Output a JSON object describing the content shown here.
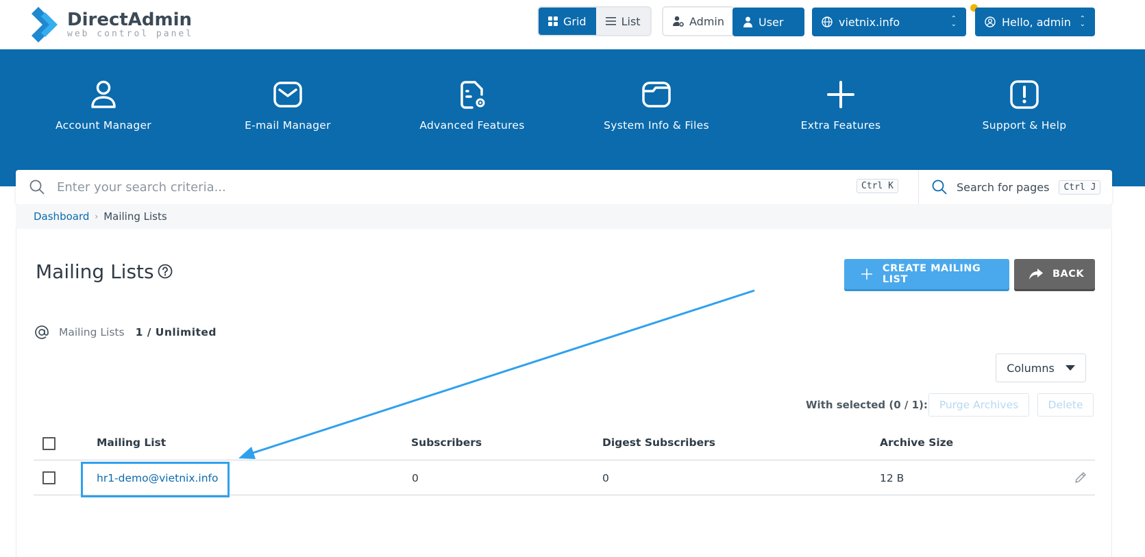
{
  "brand": {
    "title": "DirectAdmin",
    "subtitle": "web control panel"
  },
  "header": {
    "view_toggle": {
      "grid": "Grid",
      "list": "List"
    },
    "level_toggle": {
      "admin": "Admin",
      "user": "User"
    },
    "domain_selector": "vietnix.info",
    "user_menu": "Hello, admin",
    "colors": {
      "primary": "#0b6bad",
      "notification": "#f3b300"
    }
  },
  "nav": [
    {
      "label": "Account Manager",
      "icon": "user-icon"
    },
    {
      "label": "E-mail Manager",
      "icon": "envelope-icon"
    },
    {
      "label": "Advanced Features",
      "icon": "document-gear-icon"
    },
    {
      "label": "System Info & Files",
      "icon": "folder-icon"
    },
    {
      "label": "Extra Features",
      "icon": "plus-icon"
    },
    {
      "label": "Support & Help",
      "icon": "exclamation-icon"
    }
  ],
  "search": {
    "placeholder": "Enter your search criteria...",
    "shortcut": "Ctrl K",
    "pages_label": "Search for pages",
    "pages_shortcut": "Ctrl J"
  },
  "breadcrumb": {
    "home": "Dashboard",
    "current": "Mailing Lists"
  },
  "page": {
    "title": "Mailing Lists",
    "create_button": "CREATE MAILING LIST",
    "back_button": "BACK",
    "quota_label": "Mailing Lists",
    "quota_value": "1 / Unlimited",
    "columns_button": "Columns",
    "with_selected": "With selected (0 / 1):",
    "purge_button": "Purge Archives",
    "delete_button": "Delete"
  },
  "table": {
    "headers": [
      "Mailing List",
      "Subscribers",
      "Digest Subscribers",
      "Archive Size"
    ],
    "rows": [
      {
        "name": "hr1-demo@vietnix.info",
        "subscribers": "0",
        "digest": "0",
        "size": "12 B"
      }
    ]
  },
  "annotation": {
    "color": "#2fa0ee"
  }
}
